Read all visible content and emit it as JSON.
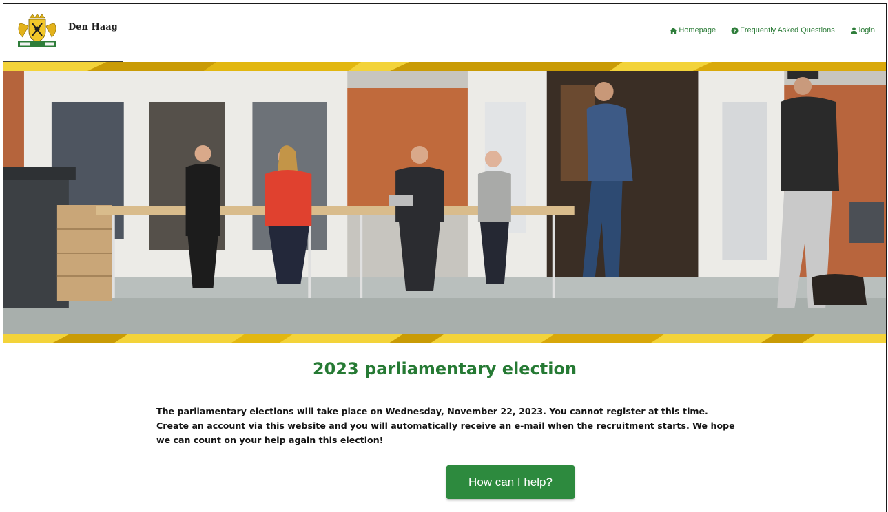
{
  "header": {
    "brand": "Den Haag",
    "nav": [
      {
        "label": "Homepage",
        "icon": "home-icon"
      },
      {
        "label": "Frequently Asked Questions",
        "icon": "question-circle-icon"
      },
      {
        "label": "login",
        "icon": "user-icon"
      }
    ]
  },
  "main": {
    "title": "2023 parliamentary election",
    "intro": "The parliamentary elections will take place on Wednesday, November 22, 2023. You cannot register at this time. Create an account via this website and you will automatically receive an e-mail when the recruitment starts. We hope we can count on your help again this election!",
    "help_button": "How can I help?"
  },
  "colors": {
    "brand_green": "#267a34",
    "button_green": "#2d8a3e",
    "stripe_yellow": "#f4d22a",
    "stripe_gold": "#c99b06"
  }
}
